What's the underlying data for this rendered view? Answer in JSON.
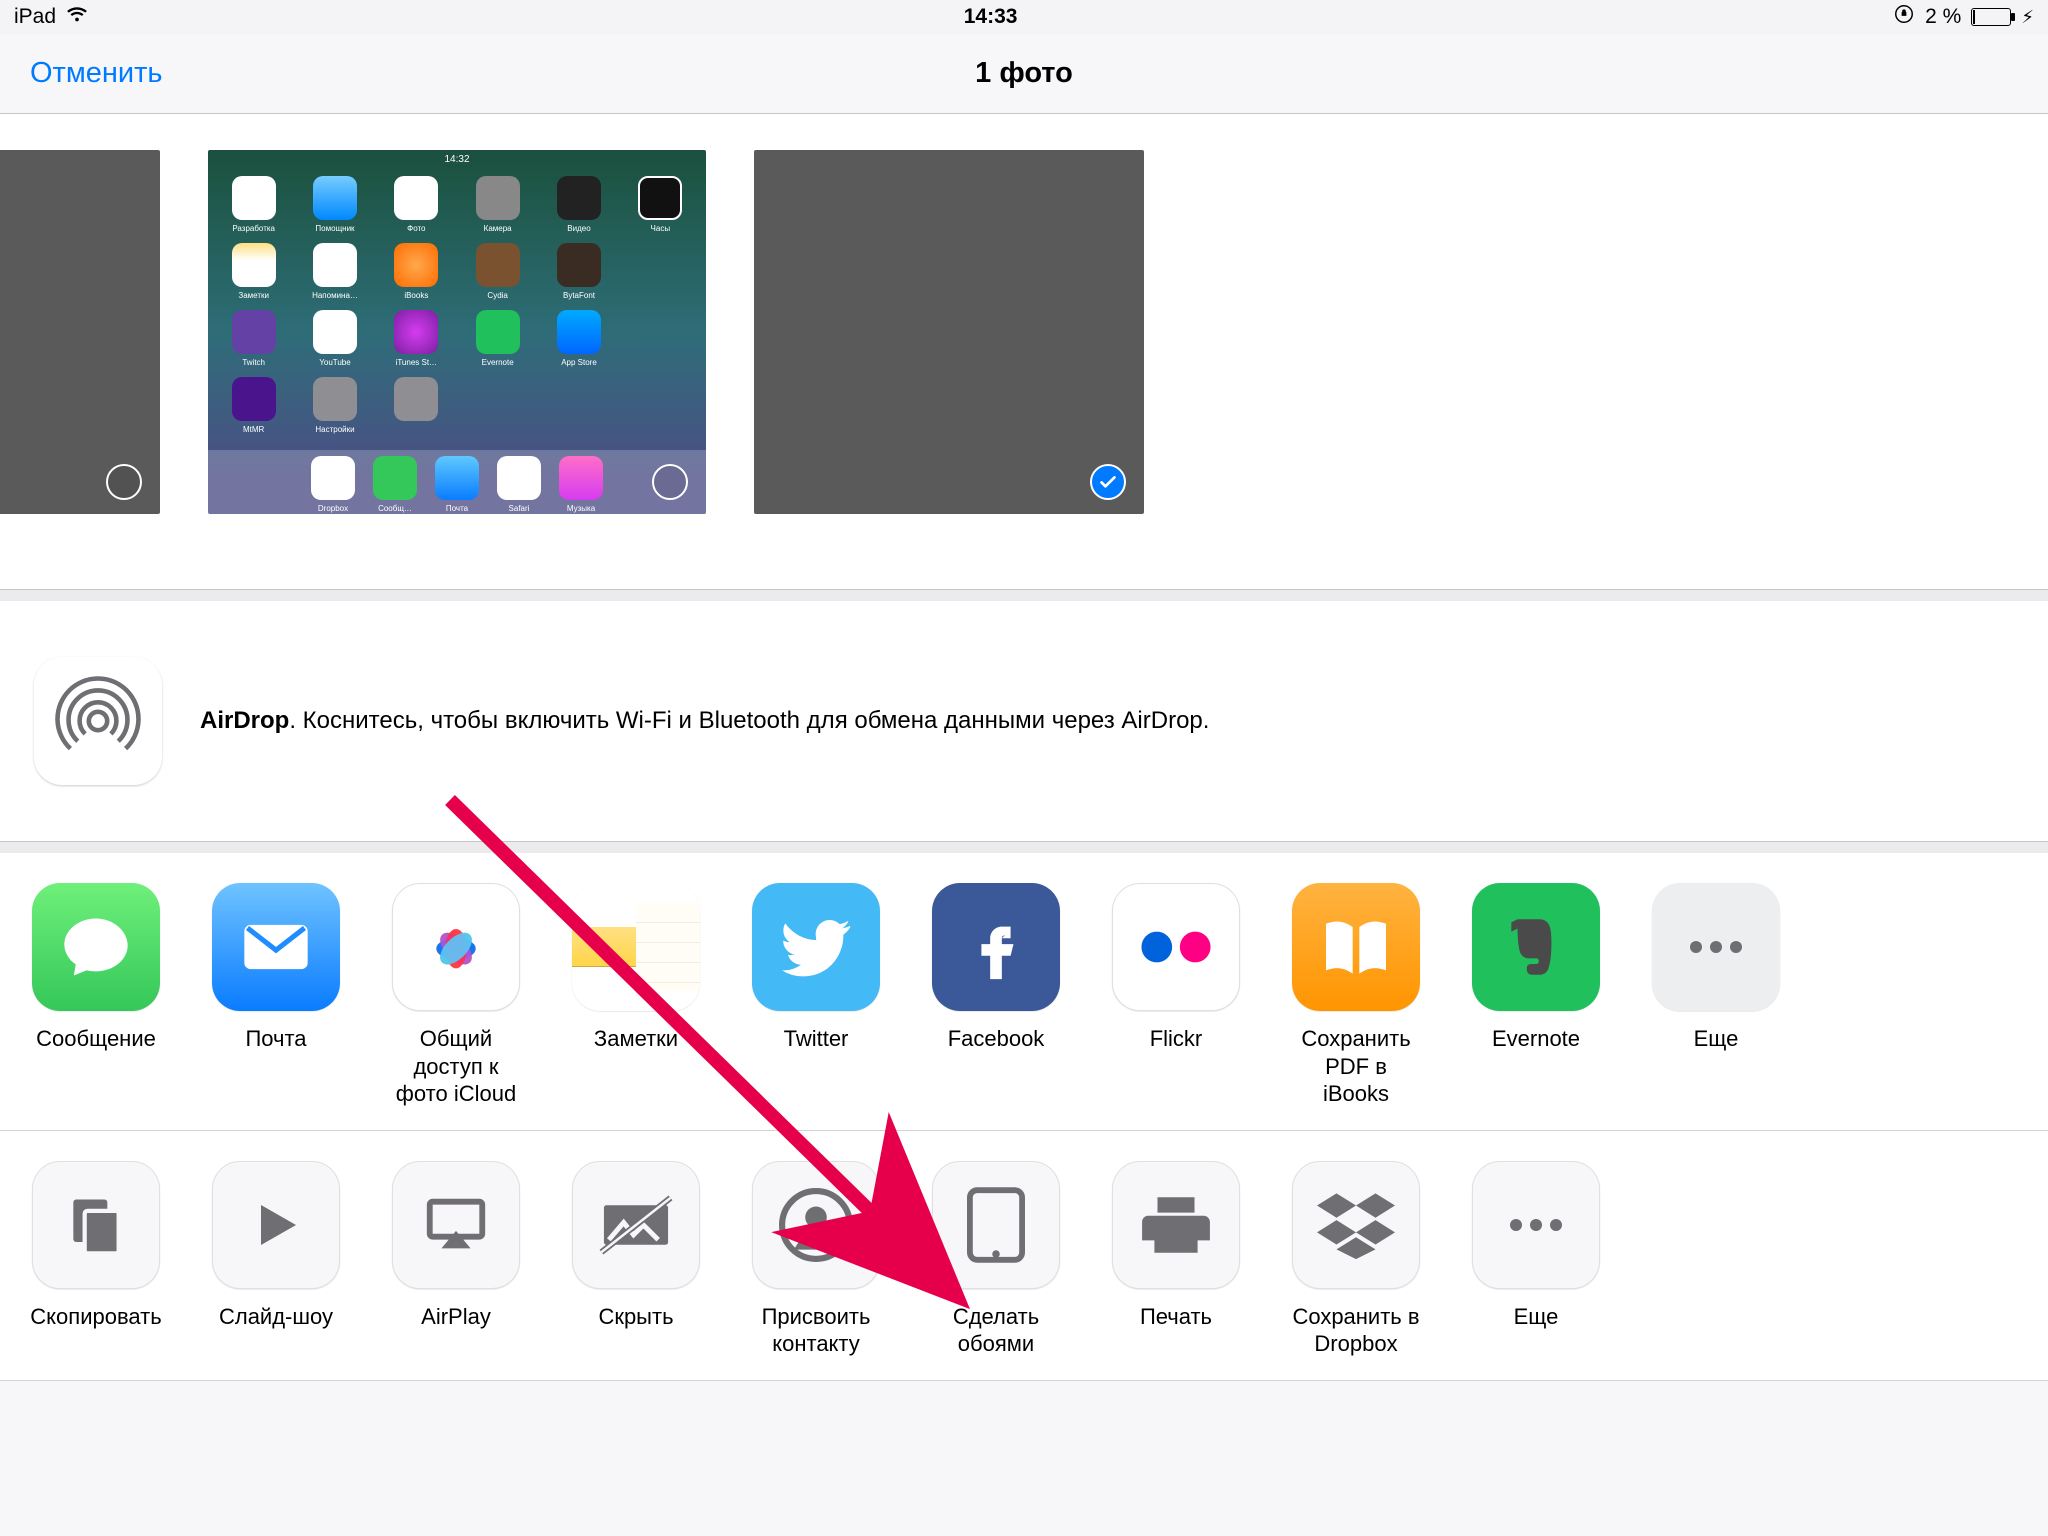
{
  "status": {
    "device": "iPad",
    "time": "14:33",
    "battery_pct": "2 %"
  },
  "nav": {
    "cancel": "Отменить",
    "title": "1 фото"
  },
  "thumbs": {
    "hs_time": "14:32"
  },
  "airdrop": {
    "title": "AirDrop",
    "text": ". Коснитесь, чтобы включить Wi‑Fi и Bluetooth для обмена данными через AirDrop."
  },
  "apps": {
    "message": "Сообщение",
    "mail": "Почта",
    "icloud_photos": "Общий доступ к фото iCloud",
    "notes": "Заметки",
    "twitter": "Twitter",
    "facebook": "Facebook",
    "flickr": "Flickr",
    "ibooks": "Сохранить PDF в iBooks",
    "evernote": "Evernote",
    "more": "Еще"
  },
  "actions": {
    "copy": "Скопировать",
    "slideshow": "Слайд-шоу",
    "airplay": "AirPlay",
    "hide": "Скрыть",
    "assign_contact": "Присвоить контакту",
    "wallpaper": "Сделать обоями",
    "print": "Печать",
    "dropbox": "Сохранить в Dropbox",
    "more": "Еще"
  },
  "colors": {
    "accent": "#007aff",
    "messages": "#4cd964",
    "mail": "#1f8cff",
    "notes": "#ffd54a",
    "twitter": "#43b9f6",
    "facebook": "#3b5998",
    "ibooks": "#ff9500",
    "evernote": "#20c05c",
    "flickr_pink": "#ff0084",
    "flickr_blue": "#0063dc",
    "arrow": "#e6004c"
  }
}
